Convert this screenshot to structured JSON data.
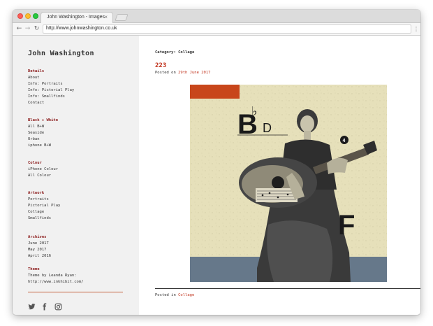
{
  "browser": {
    "tab_title": "John Washington - Images",
    "tab_close": "×",
    "url": "http://www.johnwashington.co.uk",
    "controls": {
      "back": "←",
      "forward": "→",
      "reload": "↻",
      "menu": "⋮"
    }
  },
  "sidebar": {
    "site_title": "John Washington",
    "sections": [
      {
        "heading": "Details",
        "links": [
          "About",
          "Info: Portraits",
          "Info: Pictorial Play",
          "Info: Smallfinds",
          "Contact"
        ]
      },
      {
        "heading": "Black + White",
        "links": [
          "All B+W",
          "Seaside",
          "Urban",
          "iphone B+W"
        ]
      },
      {
        "heading": "Colour",
        "links": [
          "iPhone Colour",
          "All Colour"
        ]
      },
      {
        "heading": "Artwork",
        "links": [
          "Portraits",
          "Pictorial Play",
          "Collage",
          "Smallfinds"
        ]
      },
      {
        "heading": "Archives",
        "links": [
          "June 2017",
          "May 2017",
          "April 2016"
        ]
      }
    ],
    "theme": {
      "heading": "Theme",
      "text": "Theme by Leanda Ryan:",
      "link": "http://www.inkhibit.com/"
    },
    "social_icons": [
      "twitter-icon",
      "facebook-icon",
      "instagram-icon"
    ]
  },
  "post": {
    "category_label": "Category: Collage",
    "title": "223",
    "posted_on_prefix": "Posted on ",
    "date": "29th June 2017",
    "artwork_letters": {
      "b": "B",
      "flat": "♭",
      "d": "D",
      "f": "F",
      "number": "4"
    },
    "posted_in_prefix": "Posted in ",
    "category": "Collage"
  },
  "colors": {
    "accent_red": "#c0311b",
    "heading_maroon": "#8b1a1a",
    "sidebar_bg": "#f1f1f1",
    "art_paper": "#e6e0ba",
    "art_orange": "#c8461b",
    "art_slate": "#66788a"
  }
}
